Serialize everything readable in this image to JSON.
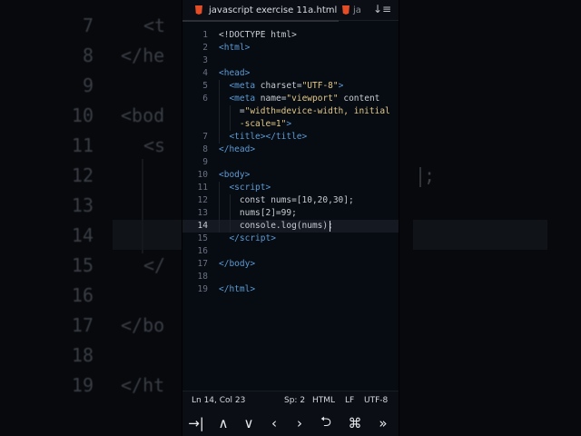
{
  "tabs": [
    {
      "label": "javascript exercise 11a.html",
      "icon": "html5-icon",
      "active": true
    },
    {
      "label": "ja",
      "icon": "html5-icon",
      "active": false
    }
  ],
  "toolbar": {
    "sort_icon": "sort-icon"
  },
  "editor": {
    "current_line": 14,
    "lines": [
      {
        "n": "1",
        "html": "<span class='p'>&lt;!DOCTYPE html&gt;</span>"
      },
      {
        "n": "2",
        "html": "<span class='t'>&lt;html&gt;</span>"
      },
      {
        "n": "3",
        "html": ""
      },
      {
        "n": "4",
        "html": "<span class='t'>&lt;head&gt;</span>"
      },
      {
        "n": "5",
        "html": "  <span class='t'>&lt;meta</span> <span class='a'>charset</span>=<span class='s'>\"UTF-8\"</span><span class='t'>&gt;</span>"
      },
      {
        "n": "6",
        "html": "  <span class='t'>&lt;meta</span> <span class='a'>name</span>=<span class='s'>\"viewport\"</span> <span class='a'>content</span>"
      },
      {
        "n": "",
        "html": "    =<span class='s'>\"width=device-width, initial</span>"
      },
      {
        "n": "",
        "html": "    <span class='s'>-scale=1\"</span><span class='t'>&gt;</span>"
      },
      {
        "n": "7",
        "html": "  <span class='t'>&lt;title&gt;&lt;/title&gt;</span>"
      },
      {
        "n": "8",
        "html": "<span class='t'>&lt;/head&gt;</span>"
      },
      {
        "n": "9",
        "html": ""
      },
      {
        "n": "10",
        "html": "<span class='t'>&lt;body&gt;</span>"
      },
      {
        "n": "11",
        "html": "  <span class='t'>&lt;script&gt;</span>"
      },
      {
        "n": "12",
        "html": "    const nums=[10,20,30];"
      },
      {
        "n": "13",
        "html": "    nums[2]=99;"
      },
      {
        "n": "14",
        "html": "    console.log(nums);"
      },
      {
        "n": "15",
        "html": "  <span class='t'>&lt;/script&gt;</span>"
      },
      {
        "n": "16",
        "html": ""
      },
      {
        "n": "17",
        "html": "<span class='t'>&lt;/body&gt;</span>"
      },
      {
        "n": "18",
        "html": ""
      },
      {
        "n": "19",
        "html": "<span class='t'>&lt;/html&gt;</span>"
      }
    ]
  },
  "status": {
    "position": "Ln 14, Col 23",
    "indent": "Sp: 2",
    "language": "HTML",
    "eol": "LF",
    "encoding": "UTF-8"
  },
  "keybar": [
    {
      "glyph": "→|",
      "name": "tab-key-button"
    },
    {
      "glyph": "∧",
      "name": "up-arrow-button"
    },
    {
      "glyph": "∨",
      "name": "down-arrow-button"
    },
    {
      "glyph": "‹",
      "name": "left-arrow-button"
    },
    {
      "glyph": "›",
      "name": "right-arrow-button"
    },
    {
      "glyph": "⮌",
      "name": "undo-button"
    },
    {
      "glyph": "⌘",
      "name": "command-button"
    },
    {
      "glyph": "»",
      "name": "more-button"
    }
  ],
  "background": {
    "left_numbers": [
      "7",
      "8",
      "9",
      "10",
      "11",
      "12",
      "13",
      "14",
      "15",
      "16",
      "17",
      "18",
      "19"
    ],
    "left_text": [
      "<t",
      "</he",
      "",
      "<bod",
      "<s",
      "",
      "",
      "",
      "</",
      "",
      "</bo",
      "",
      "</ht"
    ],
    "right_text": ";"
  }
}
